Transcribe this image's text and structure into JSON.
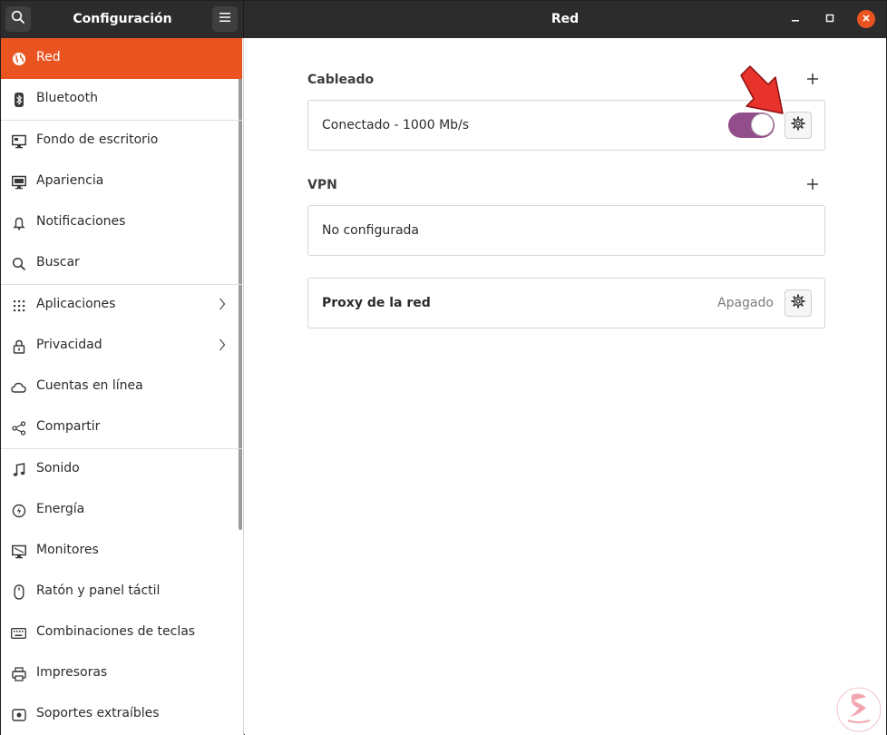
{
  "header": {
    "sidebar_title": "Configuración",
    "title": "Red",
    "search_icon": "search-icon",
    "menu_icon": "hamburger-menu-icon"
  },
  "sidebar": {
    "items": [
      {
        "label": "Red",
        "icon": "globe-icon",
        "active": true
      },
      {
        "label": "Bluetooth",
        "icon": "bluetooth-icon"
      },
      {
        "label": "Fondo de escritorio",
        "icon": "monitor-icon"
      },
      {
        "label": "Apariencia",
        "icon": "appearance-icon"
      },
      {
        "label": "Notificaciones",
        "icon": "bell-icon"
      },
      {
        "label": "Buscar",
        "icon": "search-icon"
      },
      {
        "label": "Aplicaciones",
        "icon": "grid-icon",
        "has_submenu": true
      },
      {
        "label": "Privacidad",
        "icon": "lock-icon",
        "has_submenu": true
      },
      {
        "label": "Cuentas en línea",
        "icon": "cloud-icon"
      },
      {
        "label": "Compartir",
        "icon": "share-icon"
      },
      {
        "label": "Sonido",
        "icon": "music-note-icon"
      },
      {
        "label": "Energía",
        "icon": "power-icon"
      },
      {
        "label": "Monitores",
        "icon": "display-icon"
      },
      {
        "label": "Ratón y panel táctil",
        "icon": "mouse-icon"
      },
      {
        "label": "Combinaciones de teclas",
        "icon": "keyboard-icon"
      },
      {
        "label": "Impresoras",
        "icon": "printer-icon"
      },
      {
        "label": "Soportes extraíbles",
        "icon": "media-icon"
      }
    ]
  },
  "main": {
    "wired": {
      "title": "Cableado",
      "connection_label": "Conectado - 1000 Mb/s",
      "enabled": true
    },
    "vpn": {
      "title": "VPN",
      "status_label": "No configurada"
    },
    "proxy": {
      "label": "Proxy de la red",
      "status": "Apagado"
    }
  },
  "colors": {
    "accent": "#e95420",
    "toggle_on": "#924d8b",
    "headerbar": "#2c2c2c",
    "annotation_arrow": "#e8322c"
  }
}
